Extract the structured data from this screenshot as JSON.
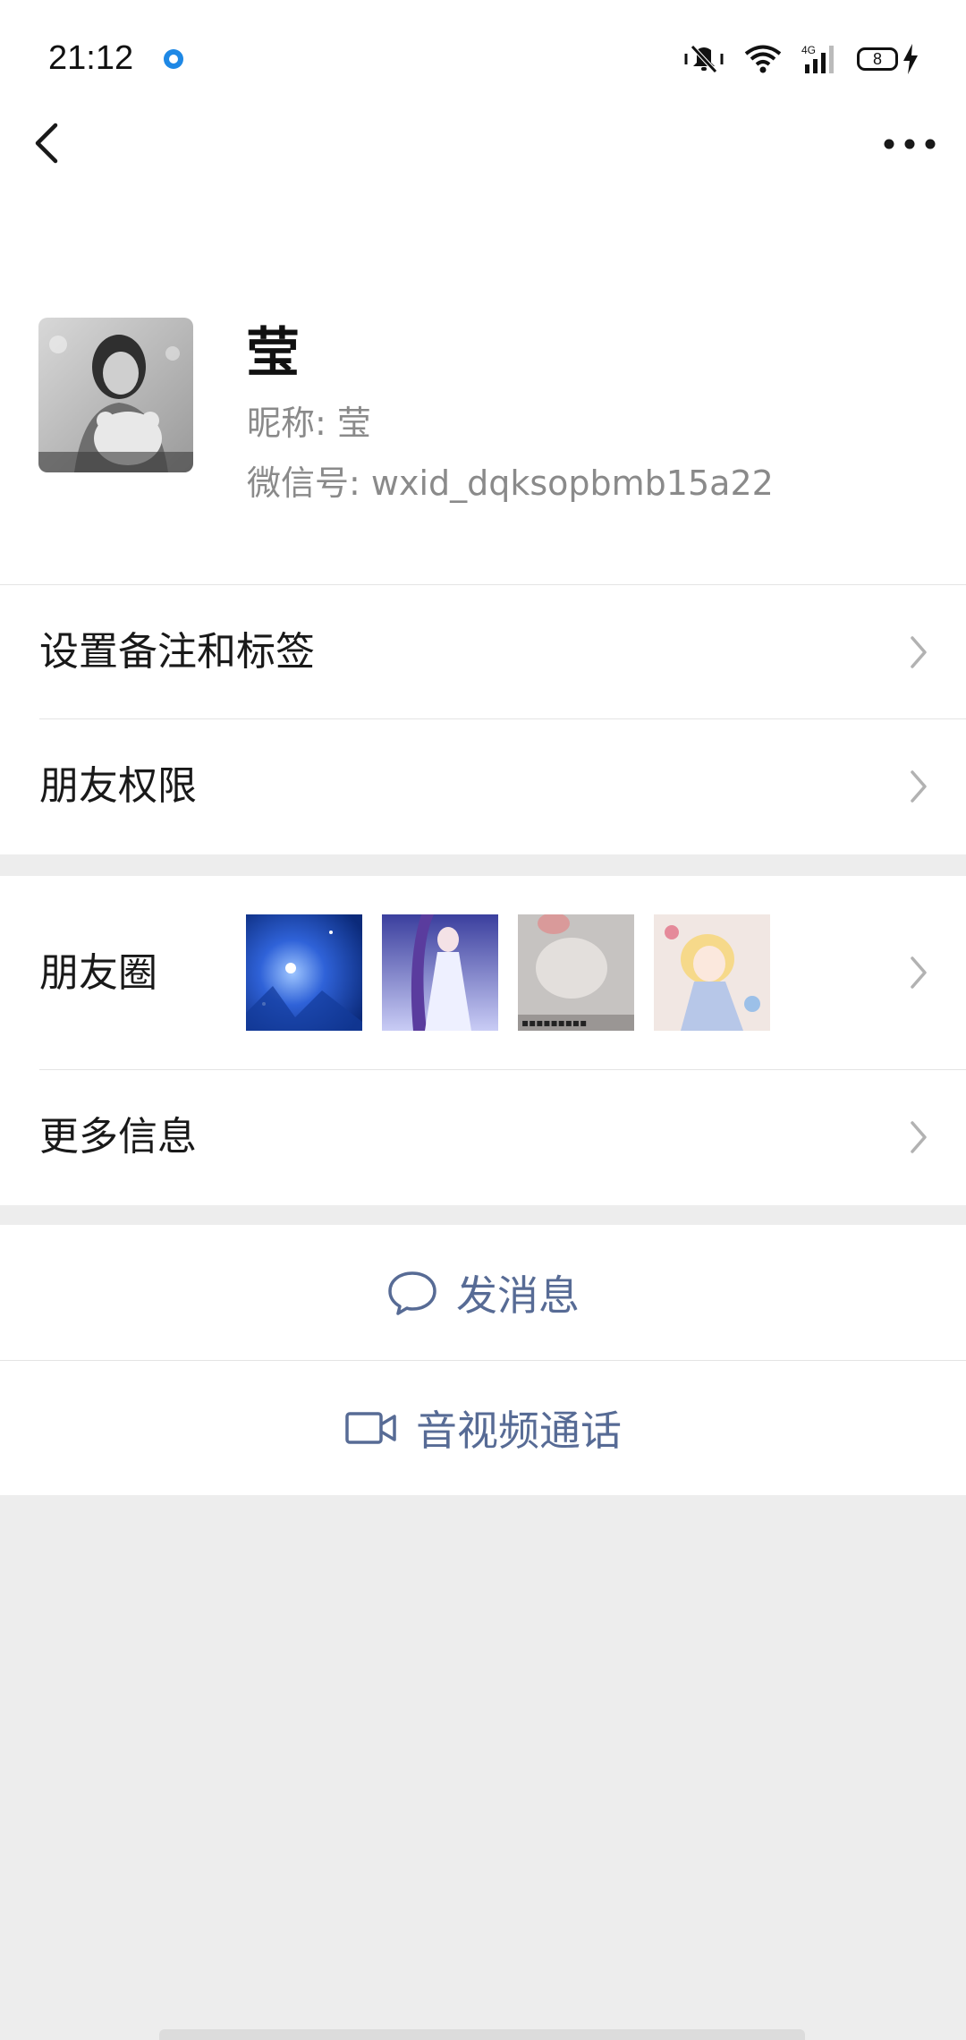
{
  "status_bar": {
    "time": "21:12",
    "network": "4G",
    "battery_level": "8"
  },
  "profile": {
    "display_name": "莹",
    "nickname": "昵称: 莹",
    "wechat_id": "微信号: wxid_dqksopbmb15a22"
  },
  "menu": {
    "set_remark": "设置备注和标签",
    "friend_permissions": "朋友权限",
    "moments": "朋友圈",
    "more_info": "更多信息"
  },
  "actions": {
    "send_message": "发消息",
    "video_call": "音视频通话"
  },
  "colors": {
    "link_blue": "#576b95",
    "background_gray": "#ededed"
  },
  "icons": [
    "back-arrow-icon",
    "more-dots-icon",
    "chevron-right-icon",
    "chat-bubble-icon",
    "video-camera-icon"
  ]
}
